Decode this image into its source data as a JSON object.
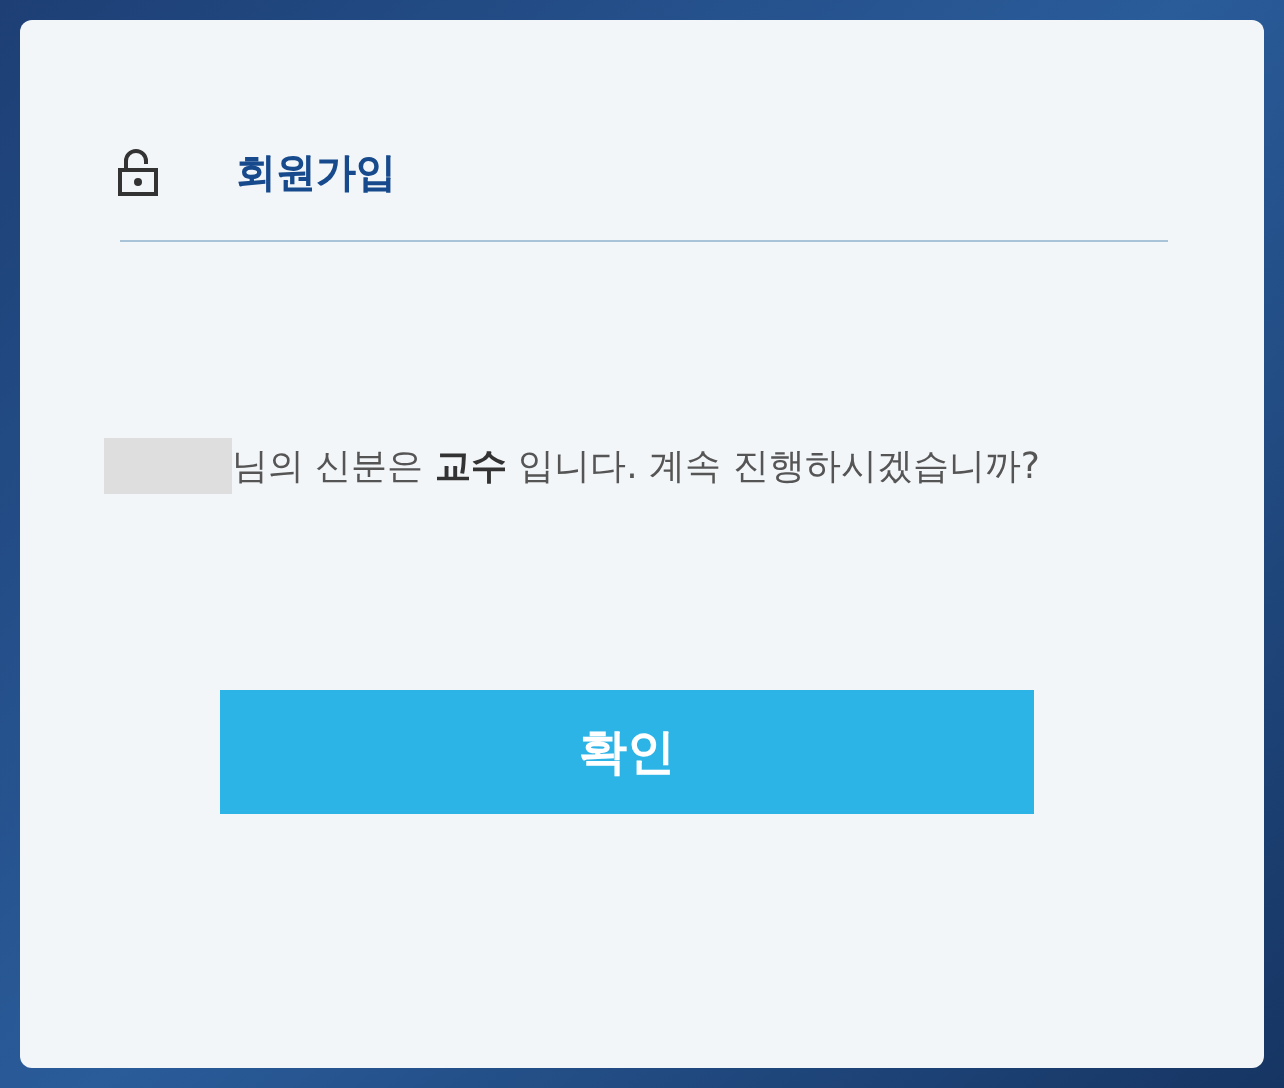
{
  "dialog": {
    "title": "회원가입",
    "message": "님의 신분은 **교수** 입니다. 계속 진행하시겠습니까?",
    "confirm_button": "확인"
  }
}
